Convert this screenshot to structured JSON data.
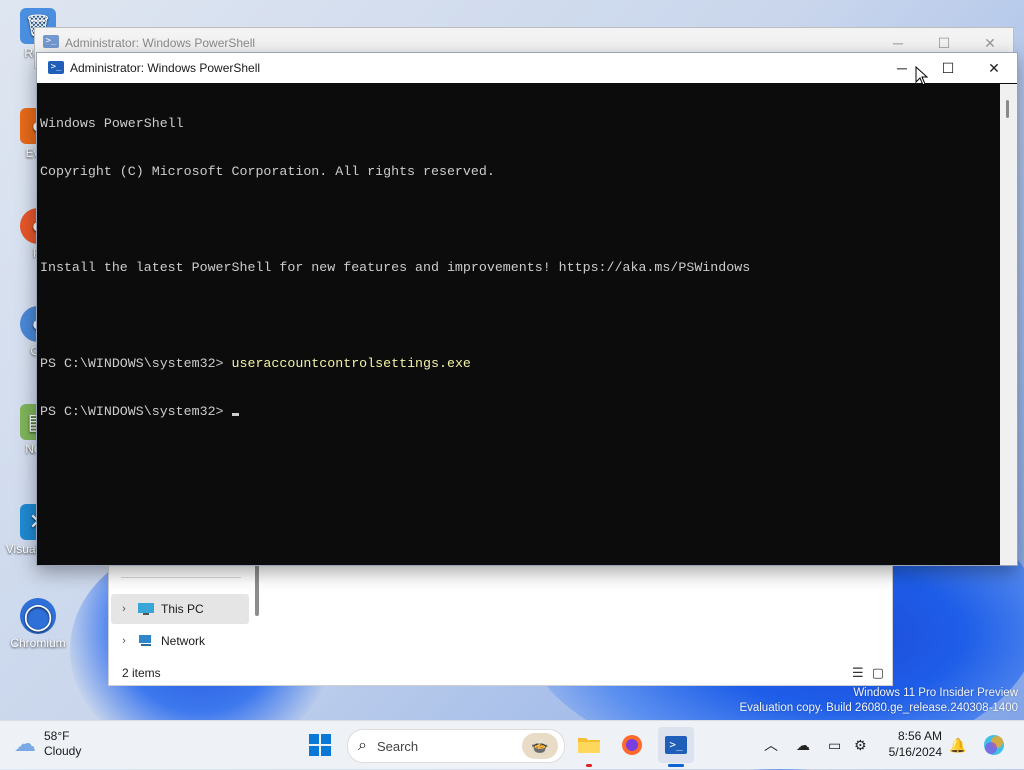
{
  "desktop": {
    "icons": [
      {
        "label": "Recy",
        "color": "#3d7fd9",
        "glyph": "🗑"
      },
      {
        "label": "Ever",
        "color": "#e86a1a",
        "glyph": "●"
      },
      {
        "label": "Fi",
        "color": "#e7552a",
        "glyph": "●"
      },
      {
        "label": "Git",
        "color": "#4a88d8",
        "glyph": "●"
      },
      {
        "label": "Note",
        "color": "#7fb55a",
        "glyph": "▤"
      },
      {
        "label": "Visual Code",
        "color": "#1f8ad2",
        "glyph": "✕"
      },
      {
        "label": "Chromium",
        "color": "#2f6fd8",
        "glyph": "◯"
      }
    ],
    "watermark": {
      "line1": "Windows 11 Pro Insider Preview",
      "line2": "Evaluation copy. Build 26080.ge_release.240308-1400"
    }
  },
  "back_window": {
    "title": "Administrator: Windows PowerShell"
  },
  "powershell": {
    "title": "Administrator: Windows PowerShell",
    "controls": {
      "minimize": "─",
      "maximize": "☐",
      "close": "✕"
    },
    "lines": {
      "l1": "Windows PowerShell",
      "l2": "Copyright (C) Microsoft Corporation. All rights reserved.",
      "l3": "",
      "l4": "Install the latest PowerShell for new features and improvements! https://aka.ms/PSWindows",
      "l5": "",
      "prompt1": "PS C:\\WINDOWS\\system32> ",
      "command1": "useraccountcontrolsettings.exe",
      "prompt2": "PS C:\\WINDOWS\\system32> "
    }
  },
  "explorer": {
    "nav": [
      {
        "label": "This PC",
        "icon": "monitor-icon",
        "selected": true
      },
      {
        "label": "Network",
        "icon": "network-icon",
        "selected": false
      }
    ],
    "status": "2 items"
  },
  "taskbar": {
    "weather": {
      "temp": "58°F",
      "condition": "Cloudy"
    },
    "search_label": "Search",
    "clock": {
      "time": "8:56 AM",
      "date": "5/16/2024"
    },
    "accent": "#0a64d6"
  }
}
